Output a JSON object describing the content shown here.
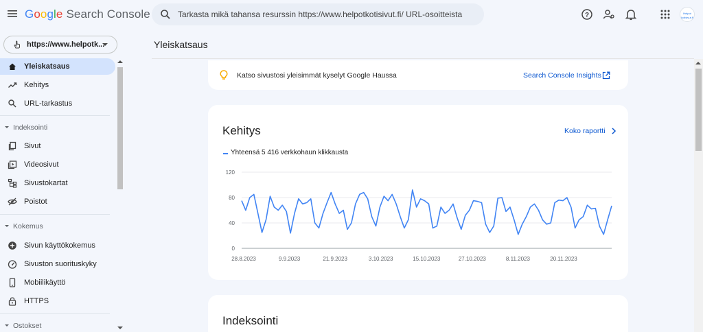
{
  "app": {
    "logo_google": [
      "G",
      "o",
      "o",
      "g",
      "l",
      "e"
    ],
    "logo_product": "Search Console"
  },
  "search": {
    "placeholder": "Tarkasta mikä tahansa resurssin https://www.helpotkotisivut.fi/ URL-osoitteista"
  },
  "header_icons": [
    "help-icon",
    "manage-users-icon",
    "notifications-icon",
    "apps-grid-icon"
  ],
  "avatar_text": "Helpot kotisivut.fi",
  "property": {
    "label": "https://www.helpotk..."
  },
  "sidebar": {
    "items_top": [
      {
        "label": "Yleiskatsaus",
        "icon": "home-icon",
        "active": true
      },
      {
        "label": "Kehitys",
        "icon": "trending-icon"
      },
      {
        "label": "URL-tarkastus",
        "icon": "search-icon"
      }
    ],
    "sections": [
      {
        "label": "Indeksointi",
        "items": [
          {
            "label": "Sivut",
            "icon": "pages-icon"
          },
          {
            "label": "Videosivut",
            "icon": "video-pages-icon"
          },
          {
            "label": "Sivustokartat",
            "icon": "sitemaps-icon"
          },
          {
            "label": "Poistot",
            "icon": "removals-icon"
          }
        ]
      },
      {
        "label": "Kokemus",
        "items": [
          {
            "label": "Sivun käyttökokemus",
            "icon": "page-experience-icon"
          },
          {
            "label": "Sivuston suorituskyky",
            "icon": "core-web-vitals-icon"
          },
          {
            "label": "Mobiilikäyttö",
            "icon": "mobile-icon"
          },
          {
            "label": "HTTPS",
            "icon": "lock-icon"
          }
        ]
      },
      {
        "label": "Ostokset",
        "items": []
      }
    ]
  },
  "main": {
    "title": "Yleiskatsaus",
    "insight": {
      "text": "Katso sivustosi yleisimmät kyselyt Google Haussa",
      "link": "Search Console Insights"
    },
    "performance": {
      "title": "Kehitys",
      "link": "Koko raportti",
      "legend": "Yhteensä 5 416 verkkohaun klikkausta"
    },
    "indexing": {
      "title": "Indeksointi"
    }
  },
  "colors": {
    "accent": "#0b57d0",
    "series": "#4285f4",
    "active_nav": "#d3e3fd",
    "page_bg": "#f3f6fc"
  },
  "chart_data": {
    "type": "line",
    "title": "",
    "xlabel": "",
    "ylabel": "",
    "ylim": [
      0,
      120
    ],
    "yticks": [
      0,
      40,
      80,
      120
    ],
    "xtick_labels": [
      "28.8.2023",
      "9.9.2023",
      "21.9.2023",
      "3.10.2023",
      "15.10.2023",
      "27.10.2023",
      "8.11.2023",
      "20.11.2023"
    ],
    "grid": true,
    "legend_position": "top-left",
    "series": [
      {
        "name": "Yhteensä 5 416 verkkohaun klikkausta",
        "values": [
          75,
          60,
          80,
          85,
          55,
          25,
          45,
          82,
          65,
          60,
          68,
          58,
          24,
          55,
          78,
          70,
          72,
          78,
          40,
          32,
          55,
          72,
          88,
          70,
          55,
          60,
          30,
          40,
          70,
          85,
          88,
          78,
          50,
          35,
          65,
          82,
          75,
          85,
          70,
          50,
          32,
          45,
          92,
          65,
          78,
          75,
          70,
          32,
          35,
          65,
          55,
          60,
          70,
          48,
          30,
          52,
          60,
          75,
          74,
          72,
          38,
          25,
          35,
          79,
          80,
          58,
          65,
          45,
          22,
          38,
          50,
          65,
          70,
          60,
          45,
          38,
          40,
          72,
          76,
          75,
          80,
          65,
          32,
          45,
          50,
          68,
          62,
          63,
          35,
          22,
          45,
          67
        ]
      }
    ]
  }
}
